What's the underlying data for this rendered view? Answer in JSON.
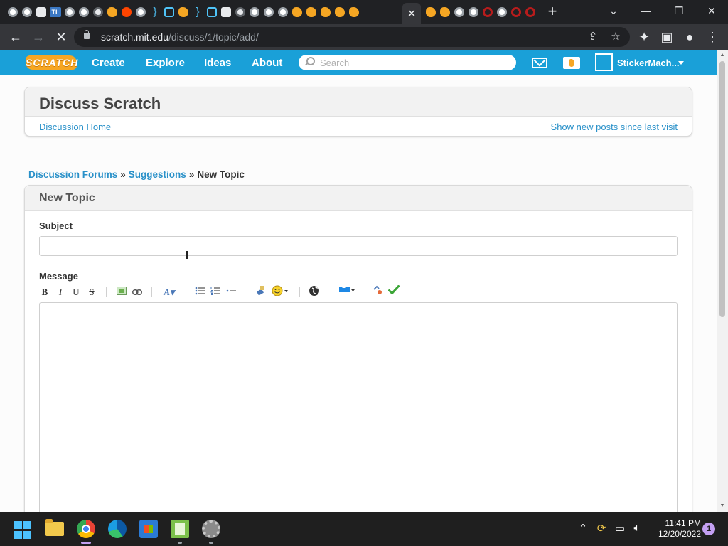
{
  "browser": {
    "tabs_icons": [
      "g",
      "g",
      "w",
      "tl",
      "g",
      "g",
      "ch",
      "sc",
      "rd",
      "g",
      "br",
      "ci",
      "sc",
      "br",
      "ci",
      "w",
      "ch",
      "g",
      "g",
      "g",
      "sc",
      "sc",
      "sc",
      "sc",
      "sc"
    ],
    "tabs_icons_right": [
      "sc",
      "sc",
      "g",
      "g",
      "q",
      "g",
      "q",
      "q"
    ],
    "tl_label": "TL",
    "url_host": "scratch.mit.edu",
    "url_path": "/discuss/1/topic/add/"
  },
  "scratch_nav": {
    "logo_text": "SCRATCH",
    "links": [
      "Create",
      "Explore",
      "Ideas",
      "About"
    ],
    "search_placeholder": "Search",
    "username": "StickerMach..."
  },
  "discuss_header": {
    "title": "Discuss Scratch",
    "home_link": "Discussion Home",
    "new_posts_link": "Show new posts since last visit"
  },
  "breadcrumb": {
    "forums": "Discussion Forums",
    "separator": "»",
    "category": "Suggestions",
    "current": "New Topic"
  },
  "new_topic": {
    "title": "New Topic",
    "subject_label": "Subject",
    "subject_value": "",
    "message_label": "Message",
    "message_value": "",
    "toolbar": {
      "bold": "B",
      "italic": "I",
      "underline": "U",
      "strike": "S"
    }
  },
  "taskbar": {
    "time": "11:41 PM",
    "date": "12/20/2022",
    "notifications": "1"
  },
  "colors": {
    "scratch_blue": "#1aa0d8",
    "link_blue": "#2a91c9",
    "scratch_orange": "#f6a623"
  }
}
